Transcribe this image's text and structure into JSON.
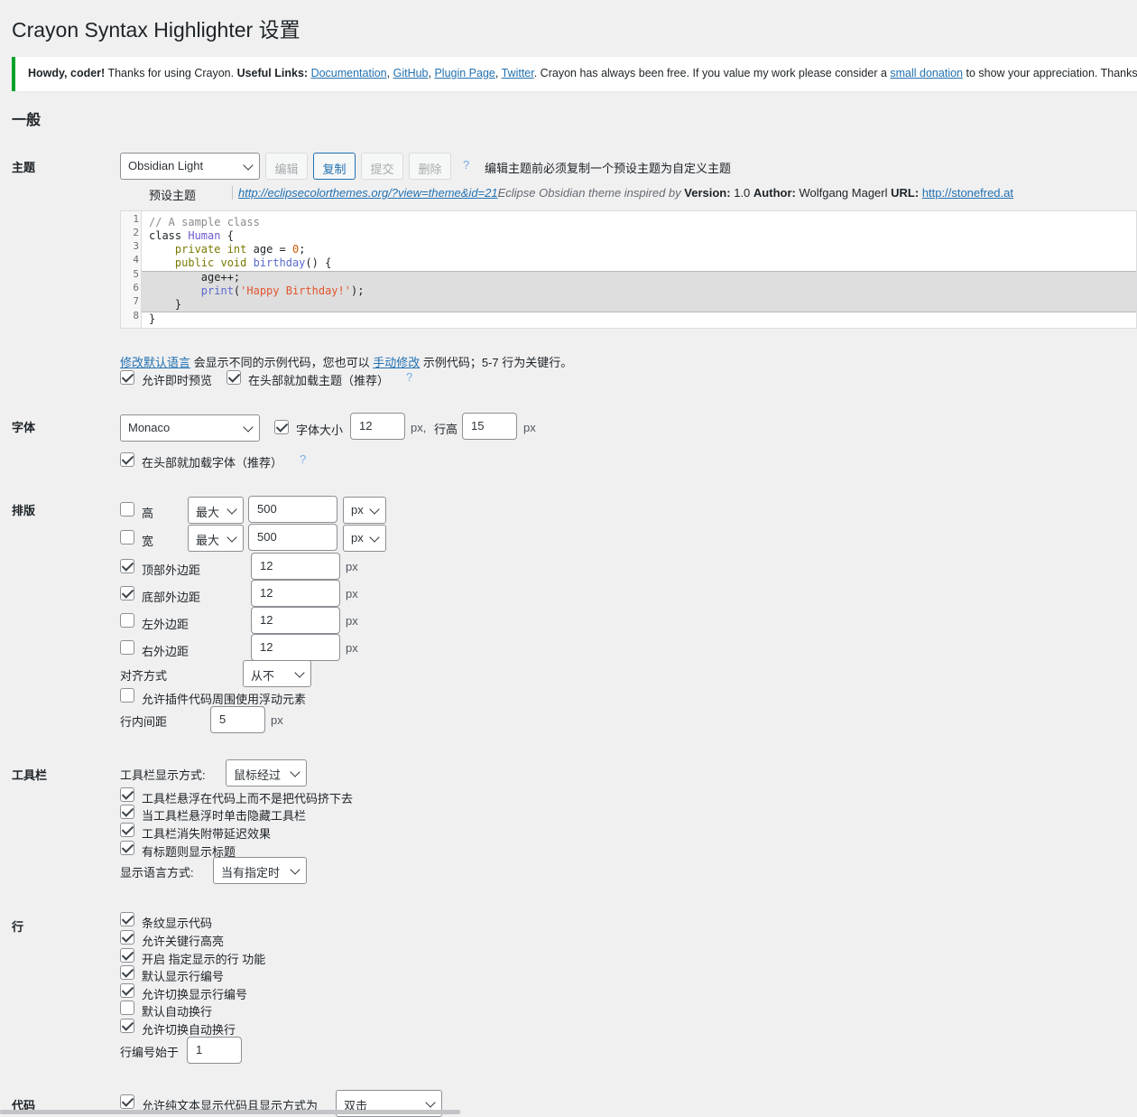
{
  "page": {
    "title": "Crayon Syntax Highlighter 设置"
  },
  "notice": {
    "howdy": "Howdy, coder!",
    "thanks": " Thanks for using Crayon. ",
    "useful_links_label": "Useful Links:",
    "links": [
      "Documentation",
      "GitHub",
      "Plugin Page",
      "Twitter"
    ],
    "free_text": ". Crayon has always been free. If you value my work please consider a ",
    "donation_link": "small donation",
    "end_text": " to show your appreciation. Thanks!"
  },
  "section": {
    "general": "一般"
  },
  "theme": {
    "label": "主题",
    "selected": "Obsidian Light",
    "buttons": {
      "edit": "编辑",
      "copy": "复制",
      "submit": "提交",
      "delete": "删除"
    },
    "help": "?",
    "hint": "编辑主题前必须复制一个预设主题为自定义主题",
    "preset_label": "预设主题",
    "info_url": "http://eclipsecolorthemes.org/?view=theme&id=21",
    "info_desc": "Eclipse Obsidian theme inspired by ",
    "version_label": "Version:",
    "version": "1.0",
    "author_label": "Author:",
    "author": "Wolfgang Magerl",
    "url_label": "URL:",
    "url": "http://stonefred.at"
  },
  "code_preview": {
    "line_numbers": [
      "1",
      "2",
      "3",
      "4",
      "5",
      "6",
      "7",
      "8"
    ],
    "l1": "// A sample class",
    "l2_kw": "class ",
    "l2_type": "Human",
    "l2_rest": " {",
    "l3_kw": "    private ",
    "l3_type": "int",
    "l3_mid": " age = ",
    "l3_num": "0",
    "l3_end": ";",
    "l4_kw": "    public void ",
    "l4_fn": "birthday",
    "l4_end": "() {",
    "l5": "        age++;",
    "l6_fn": "        print",
    "l6_open": "(",
    "l6_str": "'Happy Birthday!'",
    "l6_end": ");",
    "l7": "    }",
    "l8": "}"
  },
  "preview_opts": {
    "change_lang_link": "修改默认语言",
    "mid_text": " 会显示不同的示例代码，您也可以 ",
    "manual_link": "手动修改",
    "end_text": " 示例代码；5-7 行为关键行。",
    "live_preview": "允许即时预览",
    "load_theme_head": "在头部就加载主题（推荐）",
    "help": "?"
  },
  "font": {
    "label": "字体",
    "selected": "Monaco",
    "size_label": "字体大小",
    "size": "12",
    "px_comma": "px, ",
    "line_height_label": "行高",
    "line_height": "15",
    "px": "px",
    "load_font_head": "在头部就加载字体（推荐）",
    "help": "?"
  },
  "layout": {
    "label": "排版",
    "height_label": "高",
    "height_mode": "最大",
    "height_value": "500",
    "height_unit": "px",
    "width_label": "宽",
    "width_mode": "最大",
    "width_value": "500",
    "width_unit": "px",
    "top_margin_label": "顶部外边距",
    "top_margin": "12",
    "bottom_margin_label": "底部外边距",
    "bottom_margin": "12",
    "left_margin_label": "左外边距",
    "left_margin": "12",
    "right_margin_label": "右外边距",
    "right_margin": "12",
    "px": "px",
    "align_label": "对齐方式",
    "align": "从不",
    "float_label": "允许插件代码周围使用浮动元素",
    "tab_label": "行内间距",
    "tab_value": "5"
  },
  "toolbar": {
    "label": "工具栏",
    "display_label": "工具栏显示方式:",
    "display": "鼠标经过",
    "overlay": "工具栏悬浮在代码上而不是把代码挤下去",
    "click_hide": "当工具栏悬浮时单击隐藏工具栏",
    "delay": "工具栏消失附带延迟效果",
    "show_title": "有标题则显示标题",
    "lang_label": "显示语言方式:",
    "lang": "当有指定时"
  },
  "lines": {
    "label": "行",
    "striped": "条纹显示代码",
    "mark": "允许关键行高亮",
    "ranges": "开启 指定显示的行 功能",
    "nums": "默认显示行编号",
    "nums_toggle": "允许切换显示行编号",
    "wrap": "默认自动换行",
    "wrap_toggle": "允许切换自动换行",
    "start_label": "行编号始于",
    "start": "1"
  },
  "code": {
    "label": "代码",
    "plain_label": "允许纯文本显示代码且显示方式为",
    "plain": "双击"
  }
}
